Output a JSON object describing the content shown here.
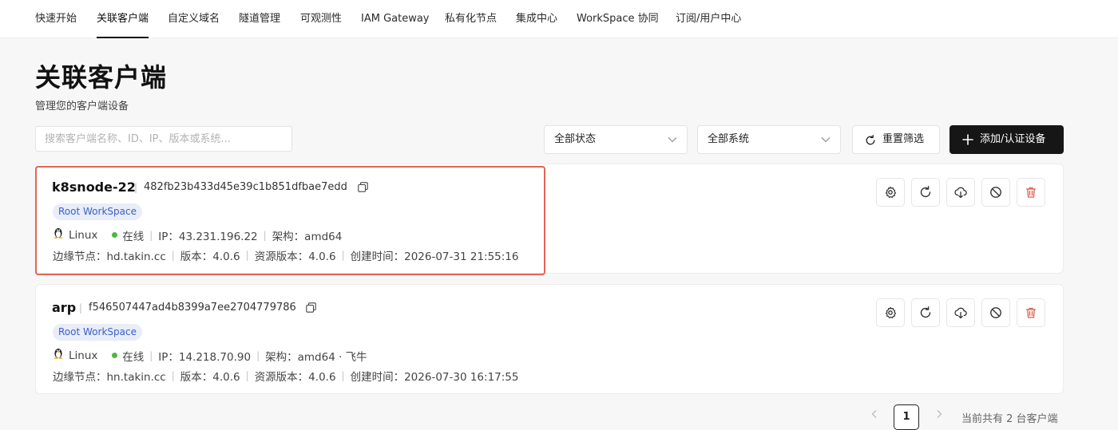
{
  "nav": {
    "tabs": [
      {
        "label": "快速开始"
      },
      {
        "label": "关联客户端",
        "active": true
      },
      {
        "label": "自定义域名"
      },
      {
        "label": "隧道管理"
      },
      {
        "label": "可观测性"
      },
      {
        "label": "IAM Gateway"
      },
      {
        "label": "私有化节点"
      },
      {
        "label": "集成中心"
      },
      {
        "label": "WorkSpace 协同"
      },
      {
        "label": "订阅/用户中心"
      }
    ]
  },
  "page": {
    "title": "关联客户端",
    "subtitle": "管理您的客户端设备"
  },
  "filters": {
    "search_placeholder": "搜索客户端名称、ID、IP、版本或系统...",
    "status_select": "全部状态",
    "system_select": "全部系统",
    "reset_label": "重置筛选",
    "add_label": "添加/认证设备"
  },
  "clients": [
    {
      "name": "k8snode-22",
      "id": "482fb23b433d45e39c1b851dfbae7edd",
      "workspace": "Root WorkSpace",
      "os": "Linux",
      "status": "在线",
      "ip_label": "IP：43.231.196.22",
      "arch_label": "架构：amd64",
      "edge_label": "边缘节点：hd.takin.cc",
      "version_label": "版本：4.0.6",
      "res_version_label": "资源版本：4.0.6",
      "created_label": "创建时间：2026-07-31 21:55:16"
    },
    {
      "name": "arp",
      "id": "f546507447ad4b8399a7ee2704779786",
      "workspace": "Root WorkSpace",
      "os": "Linux",
      "status": "在线",
      "ip_label": "IP：14.218.70.90",
      "arch_label": "架构：amd64 · 飞牛",
      "edge_label": "边缘节点：hn.takin.cc",
      "version_label": "版本：4.0.6",
      "res_version_label": "资源版本：4.0.6",
      "created_label": "创建时间：2026-07-30 16:17:55"
    }
  ],
  "pagination": {
    "current_page": "1",
    "total_text": "当前共有 2 台客户端"
  },
  "colors": {
    "accent_dark": "#161616",
    "online_dot": "#4cb83c",
    "badge_bg": "#e8edf9",
    "badge_text": "#3b5fc4",
    "highlight_border": "#e06655",
    "delete_red": "#e05a4a"
  },
  "icons": {
    "action_buttons": [
      "gear-icon",
      "refresh-icon",
      "cloud-download-icon",
      "ban-icon",
      "trash-icon"
    ]
  }
}
